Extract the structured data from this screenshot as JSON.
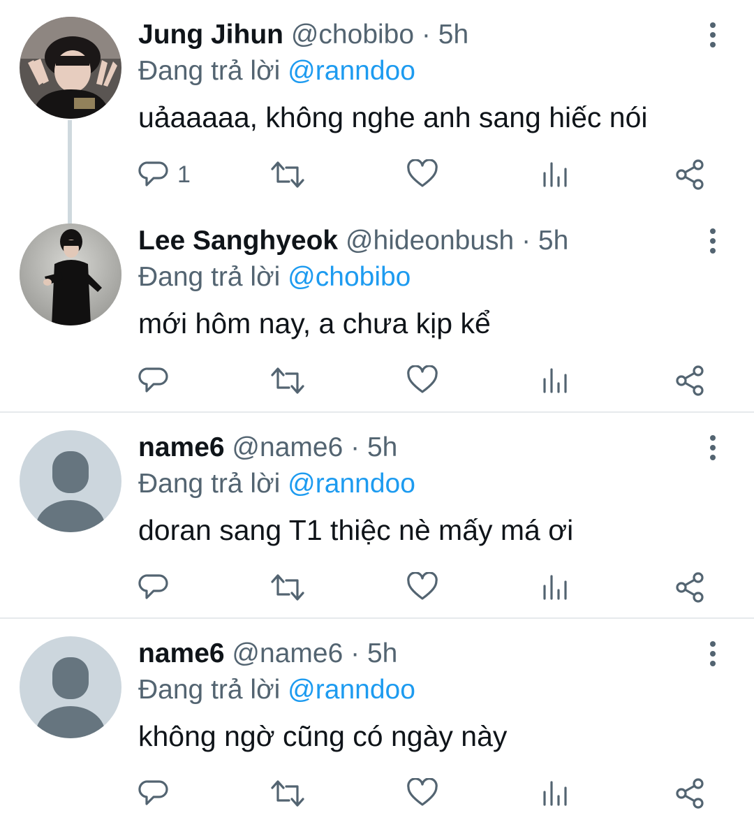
{
  "colors": {
    "text": "#0f1419",
    "secondary": "#536471",
    "accent": "#1d9bf0",
    "thread_line": "#cfd9de",
    "divider": "#e6e9ec"
  },
  "tweets": [
    {
      "name": "Jung Jihun",
      "handle": "@chobibo",
      "separator": "·",
      "time": "5h",
      "reply_prefix": "Đang trả lời",
      "reply_to": "@ranndoo",
      "text": "uảaaaaa, không nghe anh sang hiếc nói",
      "reply_count": "1",
      "avatar": "photo-avatar"
    },
    {
      "name": "Lee Sanghyeok",
      "handle": "@hideonbush",
      "separator": "·",
      "time": "5h",
      "reply_prefix": "Đang trả lời",
      "reply_to": "@chobibo",
      "text": "mới hôm nay, a chưa kịp kể",
      "reply_count": "",
      "avatar": "photo-avatar"
    },
    {
      "name": "name6",
      "handle": "@name6",
      "separator": "·",
      "time": "5h",
      "reply_prefix": "Đang trả lời",
      "reply_to": "@ranndoo",
      "text": "doran sang T1 thiệc nè mấy má ơi",
      "reply_count": "",
      "avatar": "default-avatar"
    },
    {
      "name": "name6",
      "handle": "@name6",
      "separator": "·",
      "time": "5h",
      "reply_prefix": "Đang trả lời",
      "reply_to": "@ranndoo",
      "text": "không ngờ cũng có ngày này",
      "reply_count": "",
      "avatar": "default-avatar"
    }
  ],
  "icons": {
    "reply": "reply-icon",
    "retweet": "retweet-icon",
    "like": "like-icon",
    "views": "views-icon",
    "share": "share-icon",
    "more": "more-options-icon"
  }
}
